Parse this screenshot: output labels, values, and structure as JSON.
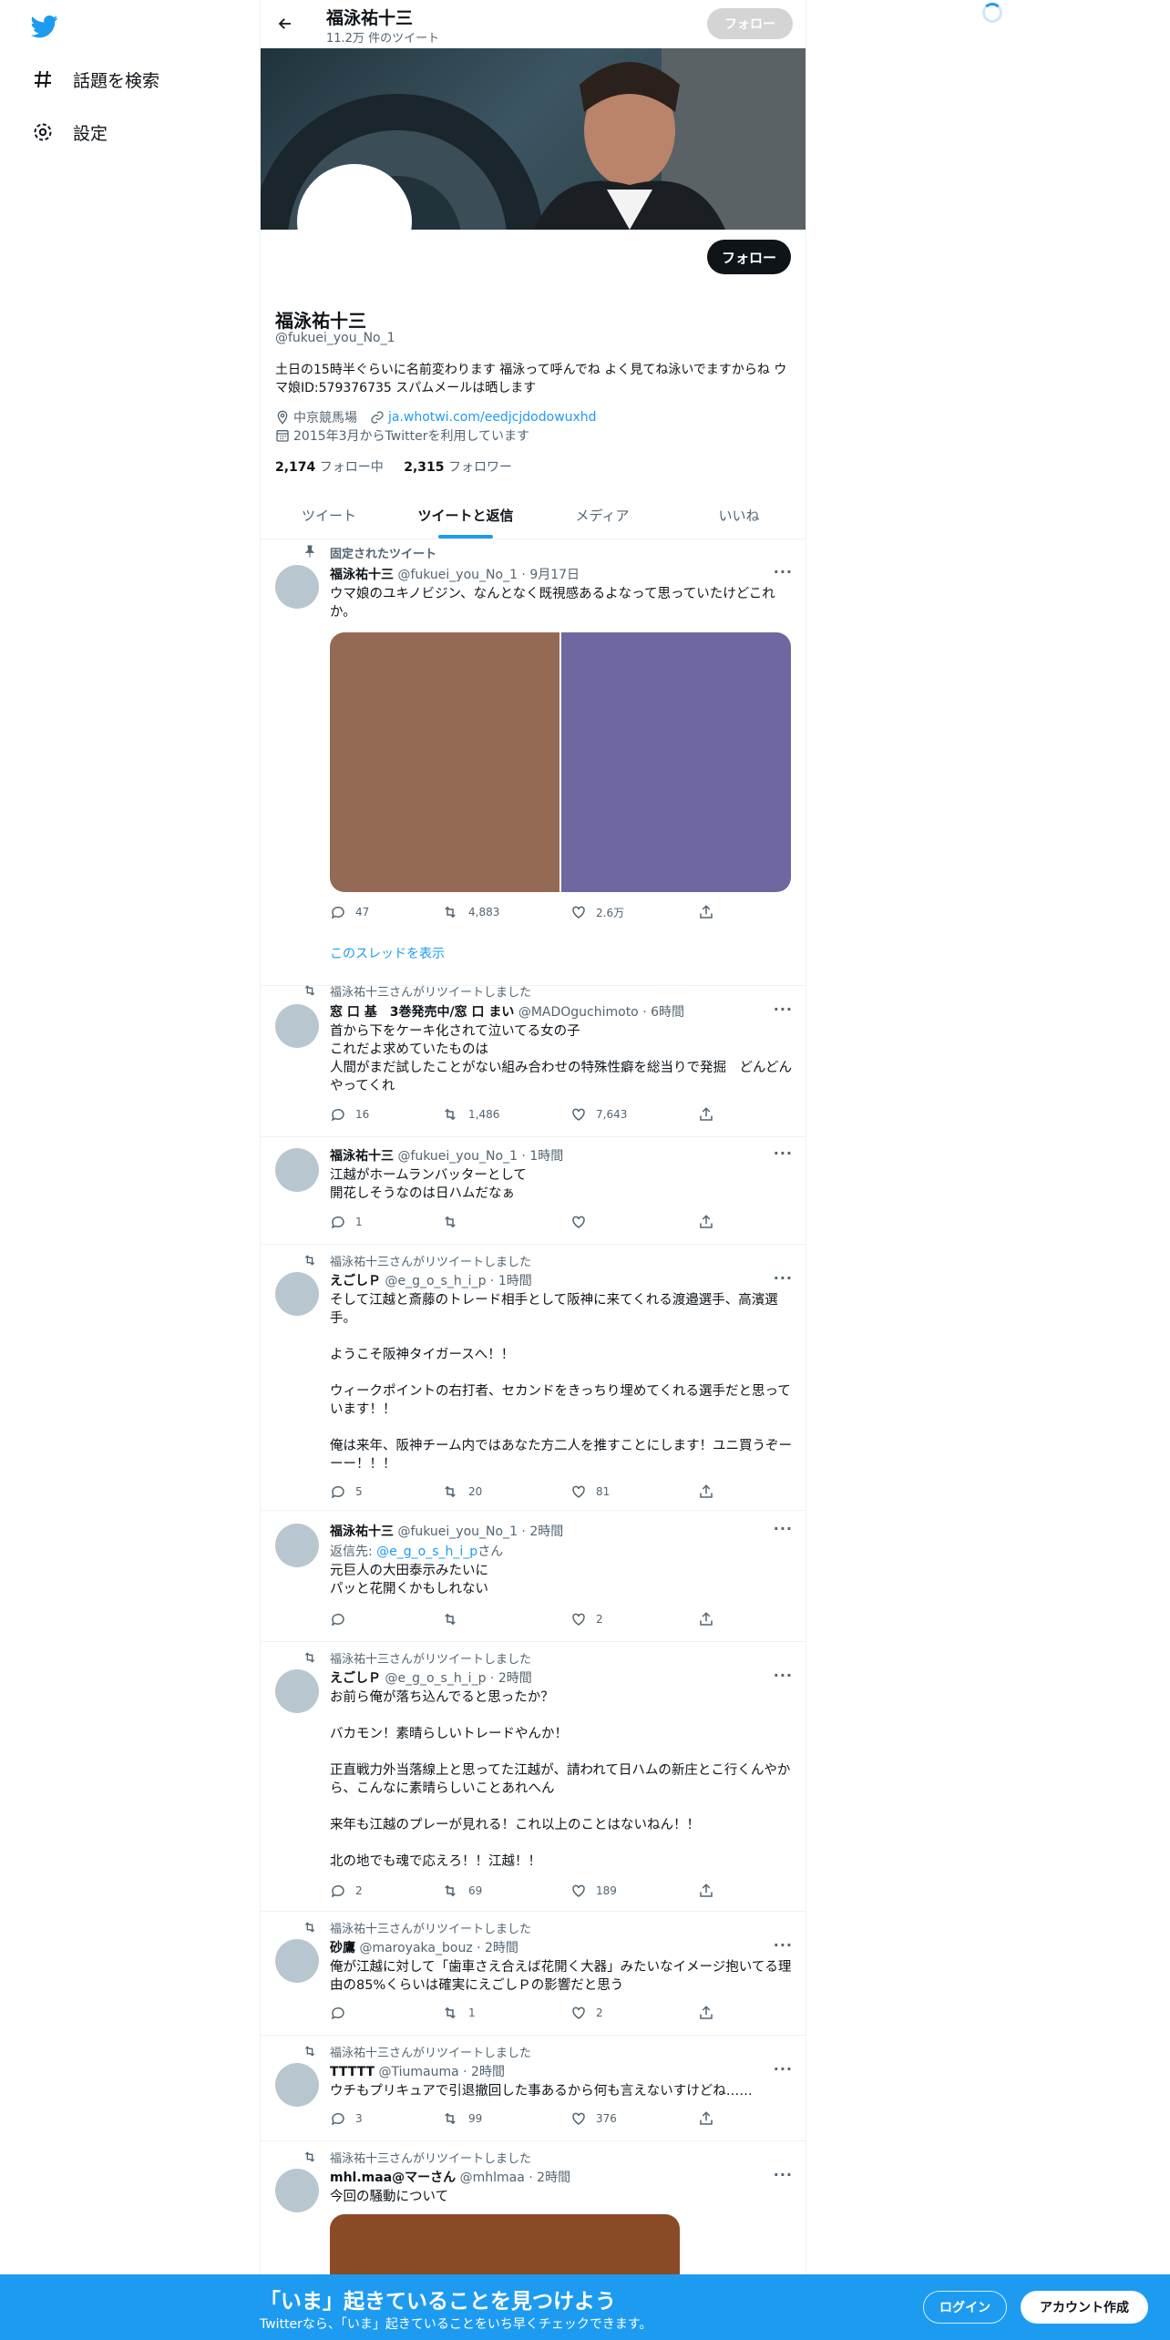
{
  "nav": {
    "explore_label": "話題を検索",
    "settings_label": "設定"
  },
  "header": {
    "name": "福泳祐十三",
    "tweet_count": "11.2万 件のツイート",
    "follow_label": "フォロー"
  },
  "profile": {
    "follow_label": "フォロー",
    "name": "福泳祐十三",
    "handle": "@fukuei_you_No_1",
    "bio": "土日の15時半ぐらいに名前変わります 福泳って呼んでね よく見てね泳いでますからね ウマ娘ID:579376735 スパムメールは晒します",
    "location": "中京競馬場",
    "url": "ja.whotwi.com/eedjcjdodowuxhd",
    "joined": "2015年3月からTwitterを利用しています",
    "following_count": "2,174",
    "following_label": "フォロー中",
    "followers_count": "2,315",
    "followers_label": "フォロワー"
  },
  "tabs": [
    "ツイート",
    "ツイートと返信",
    "メディア",
    "いいね"
  ],
  "tweets": [
    {
      "context": "固定されたツイート",
      "name": "福泳祐十三",
      "meta": "@fukuei_you_No_1 · 9月17日",
      "text": "ウマ娘のユキノビジン、なんとなく既視感あるよなって思っていたけどこれか。",
      "reply": "47",
      "retweet": "4,883",
      "like": "2.6万",
      "thread_link": "このスレッドを表示"
    },
    {
      "context": "福泳祐十三さんがリツイートしました",
      "name": "窓 口 基　3巻発売中/窓 口 まい",
      "meta": "@MADOguchimoto · 6時間",
      "text": "首から下をケーキ化されて泣いてる女の子\nこれだよ求めていたものは\n人間がまだ試したことがない組み合わせの特殊性癖を総当りで発掘　どんどんやってくれ",
      "reply": "16",
      "retweet": "1,486",
      "like": "7,643"
    },
    {
      "name": "福泳祐十三",
      "meta": "@fukuei_you_No_1 · 1時間",
      "text": "江越がホームランバッターとして\n開花しそうなのは日ハムだなぁ",
      "reply": "1",
      "retweet": "",
      "like": ""
    },
    {
      "context": "福泳祐十三さんがリツイートしました",
      "name": "えごしＰ",
      "meta": "@e_g_o_s_h_i_p · 1時間",
      "text": "そして江越と斎藤のトレード相手として阪神に来てくれる渡邉選手、高濱選手。\n\nようこそ阪神タイガースへ！！\n\nウィークポイントの右打者、セカンドをきっちり埋めてくれる選手だと思っています！！\n\n俺は来年、阪神チーム内ではあなた方二人を推すことにします！ユニ買うぞーーー！！！",
      "reply": "5",
      "retweet": "20",
      "like": "81"
    },
    {
      "name": "福泳祐十三",
      "meta": "@fukuei_you_No_1 · 2時間",
      "reply_prefix": "返信先: ",
      "reply_to": "@e_g_o_s_h_i_p",
      "reply_suffix": "さん",
      "text": "元巨人の大田泰示みたいに\nパッと花開くかもしれない",
      "reply": "",
      "retweet": "",
      "like": "2"
    },
    {
      "context": "福泳祐十三さんがリツイートしました",
      "name": "えごしＰ",
      "meta": "@e_g_o_s_h_i_p · 2時間",
      "text": "お前ら俺が落ち込んでると思ったか？\n\nバカモン！素晴らしいトレードやんか！\n\n正直戦力外当落線上と思ってた江越が、請われて日ハムの新庄とこ行くんやから、こんなに素晴らしいことあれへん\n\n来年も江越のプレーが見れる！これ以上のことはないねん！！\n\n北の地でも魂で応えろ！！江越！！",
      "reply": "2",
      "retweet": "69",
      "like": "189"
    },
    {
      "context": "福泳祐十三さんがリツイートしました",
      "name": "砂鷹",
      "meta": "@maroyaka_bouz · 2時間",
      "text": "俺が江越に対して「歯車さえ合えば花開く大器」みたいなイメージ抱いてる理由の85%くらいは確実にえごしＰの影響だと思う",
      "reply": "",
      "retweet": "1",
      "like": "2"
    },
    {
      "context": "福泳祐十三さんがリツイートしました",
      "name": "TTTTT",
      "meta": "@Tiumauma · 2時間",
      "text": "ウチもプリキュアで引退撤回した事あるから何も言えないすけどね……",
      "reply": "3",
      "retweet": "99",
      "like": "376"
    },
    {
      "context": "福泳祐十三さんがリツイートしました",
      "name": "mhl.maa@マーさん",
      "meta": "@mhlmaa · 2時間",
      "text": "今回の騒動について"
    }
  ],
  "cta": {
    "title": "「いま」起きていることを見つけよう",
    "subtitle": "Twitterなら、「いま」起きていることをいち早くチェックできます。",
    "login_label": "ログイン",
    "signup_label": "アカウント作成"
  },
  "colors": {
    "accent": "#1d9bf0",
    "media_left": "#946a55",
    "media_right": "#6e67a0",
    "media_bottom": "#8b4a26"
  },
  "icons": [
    "twitter-logo-icon",
    "hashtag-icon",
    "gear-icon",
    "back-arrow-icon",
    "location-icon",
    "link-icon",
    "calendar-icon",
    "pin-icon",
    "retweet-icon",
    "reply-icon",
    "like-icon",
    "share-icon",
    "more-icon"
  ]
}
